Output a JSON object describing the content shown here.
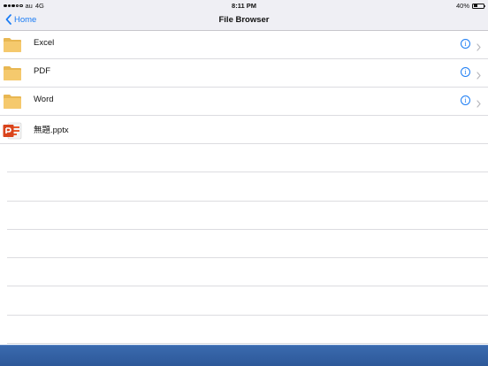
{
  "status_bar": {
    "carrier": "au",
    "network": "4G",
    "time": "8:11 PM",
    "battery_text": "40%",
    "battery_level": 0.4
  },
  "nav": {
    "back_label": "Home",
    "title": "File Browser"
  },
  "files": [
    {
      "name": "Excel",
      "icon": "folder-icon",
      "has_info": true
    },
    {
      "name": "PDF",
      "icon": "folder-icon",
      "has_info": true
    },
    {
      "name": "Word",
      "icon": "folder-icon",
      "has_info": true
    },
    {
      "name": "無題.pptx",
      "icon": "powerpoint-file-icon",
      "has_info": false
    }
  ],
  "info_glyph": "i",
  "colors": {
    "accent": "#1a7cf4",
    "toolbar": "#2d5899",
    "folder": "#f5c96d"
  }
}
